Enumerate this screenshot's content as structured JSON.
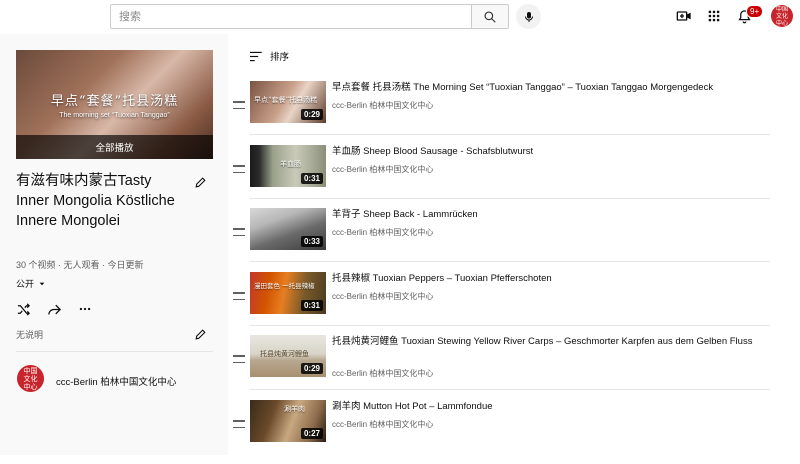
{
  "search": {
    "placeholder": "搜索"
  },
  "header": {
    "notification_count": "9+",
    "avatar_text": "中国文化中心"
  },
  "playlist": {
    "hero_title": "早点“套餐”托县汤糕",
    "hero_subtitle": "The morning set “Tuoxian Tanggao”",
    "play_all": "全部播放",
    "title": "有滋有味内蒙古Tasty Inner Mongolia Köstliche Innere Mongolei",
    "stats": "30 个视频 · 无人观看 · 今日更新",
    "privacy": "公开",
    "no_description": "无说明",
    "channel": {
      "avatar_text": "中国文化中心",
      "name": "ccc-Berlin 柏林中国文化中心"
    }
  },
  "list": {
    "sort_label": "排序",
    "videos": [
      {
        "title": "早点套餐 托县汤糕 The Morning Set “Tuoxian Tanggao” – Tuoxian Tanggao Morgengedeck",
        "channel": "ccc-Berlin 柏林中国文化中心",
        "duration": "0:29",
        "caption": "早点“套餐”托县汤糕"
      },
      {
        "title": "羊血肠 Sheep Blood Sausage - Schafsblutwurst",
        "channel": "ccc-Berlin 柏林中国文化中心",
        "duration": "0:31",
        "caption": "羊血肠"
      },
      {
        "title": "羊背子 Sheep Back - Lammrücken",
        "channel": "ccc-Berlin 柏林中国文化中心",
        "duration": "0:33",
        "caption": ""
      },
      {
        "title": "托县辣椒 Tuoxian Peppers – Tuoxian Pfefferschoten",
        "channel": "ccc-Berlin 柏林中国文化中心",
        "duration": "0:31",
        "caption": "漫田套色 一托县辣椒"
      },
      {
        "title": "托县炖黄河鲤鱼 Tuoxian Stewing Yellow River Carps – Geschmorter Karpfen aus dem Gelben Fluss",
        "channel": "ccc-Berlin 柏林中国文化中心",
        "duration": "0:29",
        "caption": "托县炖黄河鲤鱼"
      },
      {
        "title": "涮羊肉 Mutton Hot Pot – Lammfondue",
        "channel": "ccc-Berlin 柏林中国文化中心",
        "duration": "0:27",
        "caption": "涮羊肉"
      }
    ]
  },
  "colors": {
    "accent_red": "#cc0000",
    "brand_red": "#c8242b",
    "text_secondary": "#606060",
    "panel_bg": "#f9f9f9"
  }
}
